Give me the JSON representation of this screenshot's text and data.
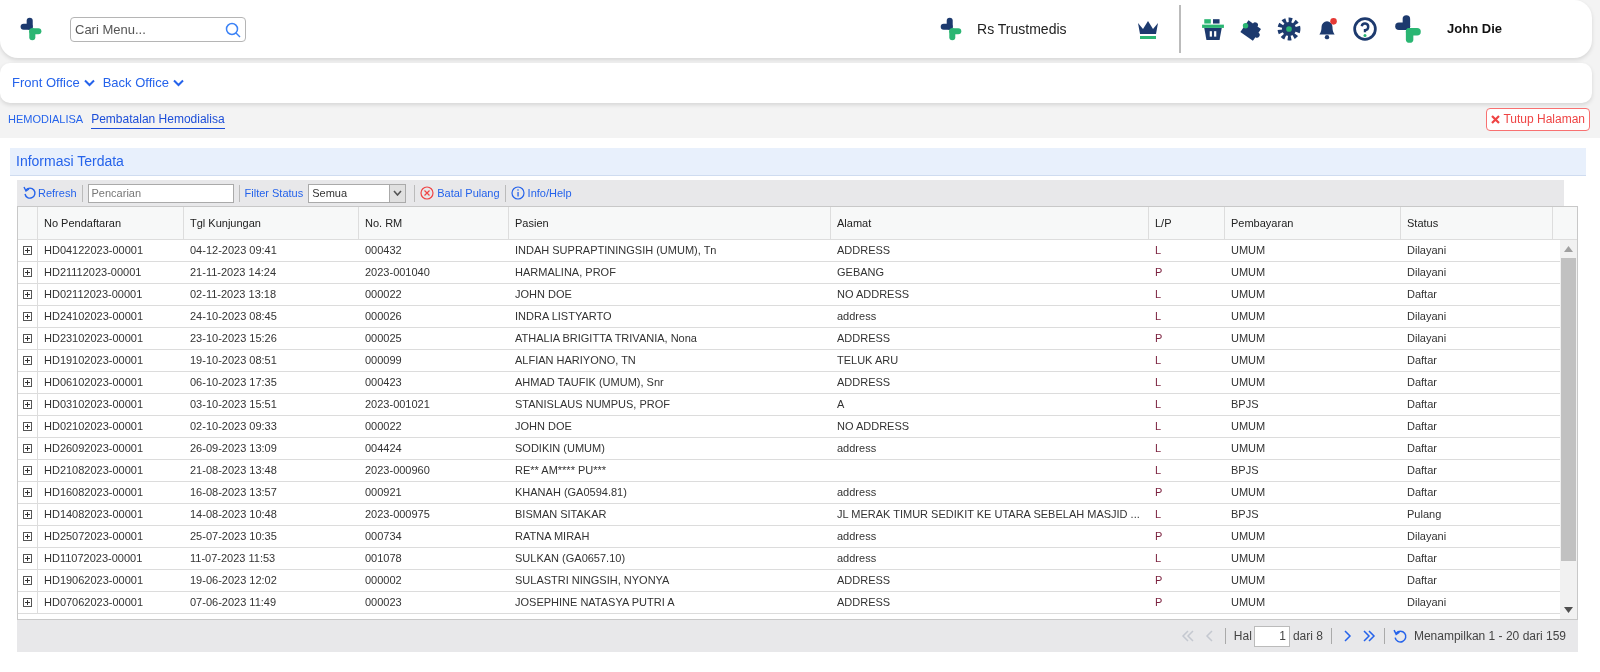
{
  "header": {
    "search": {
      "placeholder": "Cari Menu..."
    },
    "hospital_name": "Rs Trustmedis",
    "notification_unread": true,
    "user_name": "John Die"
  },
  "nav": [
    {
      "label": "Front Office"
    },
    {
      "label": "Back Office"
    }
  ],
  "breadcrumb": [
    {
      "label": "HEMODIALISA",
      "selected": false
    },
    {
      "label": "Pembatalan Hemodialisa",
      "selected": true
    }
  ],
  "close_button": "Tutup Halaman",
  "panel": {
    "title": "Informasi Terdata",
    "toolbar": {
      "refresh": "Refresh",
      "search_placeholder": "Pencarian",
      "filter_label": "Filter Status",
      "filter_value": "Semua",
      "cancel_button": "Batal Pulang",
      "help_button": "Info/Help"
    },
    "table": {
      "columns": [
        "No Pendaftaran",
        "Tgl Kunjungan",
        "No. RM",
        "Pasien",
        "Alamat",
        "L/P",
        "Pembayaran",
        "Status"
      ],
      "rows": [
        [
          "HD04122023-00001",
          "04-12-2023 09:41",
          "000432",
          "INDAH SUPRAPTININGSIH (UMUM), Tn",
          "ADDRESS",
          "L",
          "UMUM",
          "Dilayani"
        ],
        [
          "HD21112023-00001",
          "21-11-2023 14:24",
          "2023-001040",
          "HARMALINA, PROF",
          "GEBANG",
          "P",
          "UMUM",
          "Dilayani"
        ],
        [
          "HD02112023-00001",
          "02-11-2023 13:18",
          "000022",
          "JOHN DOE",
          "NO ADDRESS",
          "L",
          "UMUM",
          "Daftar"
        ],
        [
          "HD24102023-00001",
          "24-10-2023 08:45",
          "000026",
          "INDRA LISTYARTO",
          "address",
          "L",
          "UMUM",
          "Dilayani"
        ],
        [
          "HD23102023-00001",
          "23-10-2023 15:26",
          "000025",
          "ATHALIA BRIGITTA TRIVANIA, Nona",
          "ADDRESS",
          "P",
          "UMUM",
          "Dilayani"
        ],
        [
          "HD19102023-00001",
          "19-10-2023 08:51",
          "000099",
          "ALFIAN HARIYONO, TN",
          "TELUK ARU",
          "L",
          "UMUM",
          "Daftar"
        ],
        [
          "HD06102023-00001",
          "06-10-2023 17:35",
          "000423",
          "AHMAD TAUFIK (UMUM), Snr",
          "ADDRESS",
          "L",
          "UMUM",
          "Daftar"
        ],
        [
          "HD03102023-00001",
          "03-10-2023 15:51",
          "2023-001021",
          "STANISLAUS NUMPUS, PROF",
          "A",
          "L",
          "BPJS",
          "Daftar"
        ],
        [
          "HD02102023-00001",
          "02-10-2023 09:33",
          "000022",
          "JOHN DOE",
          "NO ADDRESS",
          "L",
          "UMUM",
          "Daftar"
        ],
        [
          "HD26092023-00001",
          "26-09-2023 13:09",
          "004424",
          "SODIKIN (UMUM)",
          "address",
          "L",
          "UMUM",
          "Daftar"
        ],
        [
          "HD21082023-00001",
          "21-08-2023 13:48",
          "2023-000960",
          "RE** AM**** PU***",
          null,
          "L",
          "BPJS",
          "Daftar"
        ],
        [
          "HD16082023-00001",
          "16-08-2023 13:57",
          "000921",
          "KHANAH (GA0594.81)",
          "address",
          "P",
          "UMUM",
          "Daftar"
        ],
        [
          "HD14082023-00001",
          "14-08-2023 10:48",
          "2023-000975",
          "BISMAN SITAKAR",
          "JL MERAK TIMUR SEDIKIT KE UTARA SEBELAH MASJID ...",
          "L",
          "BPJS",
          "Pulang"
        ],
        [
          "HD25072023-00001",
          "25-07-2023 10:35",
          "000734",
          "RATNA MIRAH",
          "address",
          "P",
          "UMUM",
          "Dilayani"
        ],
        [
          "HD11072023-00001",
          "11-07-2023 11:53",
          "001078",
          "SULKAN (GA0657.10)",
          "address",
          "L",
          "UMUM",
          "Daftar"
        ],
        [
          "HD19062023-00001",
          "19-06-2023 12:02",
          "000002",
          "SULASTRI NINGSIH, NYONYA",
          "ADDRESS",
          "P",
          "UMUM",
          "Daftar"
        ],
        [
          "HD07062023-00001",
          "07-06-2023 11:49",
          "000023",
          "JOSEPHINE NATASYA PUTRI A",
          "ADDRESS",
          "P",
          "UMUM",
          "Dilayani"
        ]
      ]
    },
    "pager": {
      "buttons": [
        {
          "kind": "first",
          "disabled": true
        },
        {
          "kind": "prev",
          "disabled": true
        },
        {
          "kind": "next",
          "disabled": false
        },
        {
          "kind": "last",
          "disabled": false
        }
      ],
      "page_label": "Hal",
      "page_value": "1",
      "page_total": "dari 8",
      "summary": "Menampilkan 1 - 20 dari 159"
    }
  }
}
